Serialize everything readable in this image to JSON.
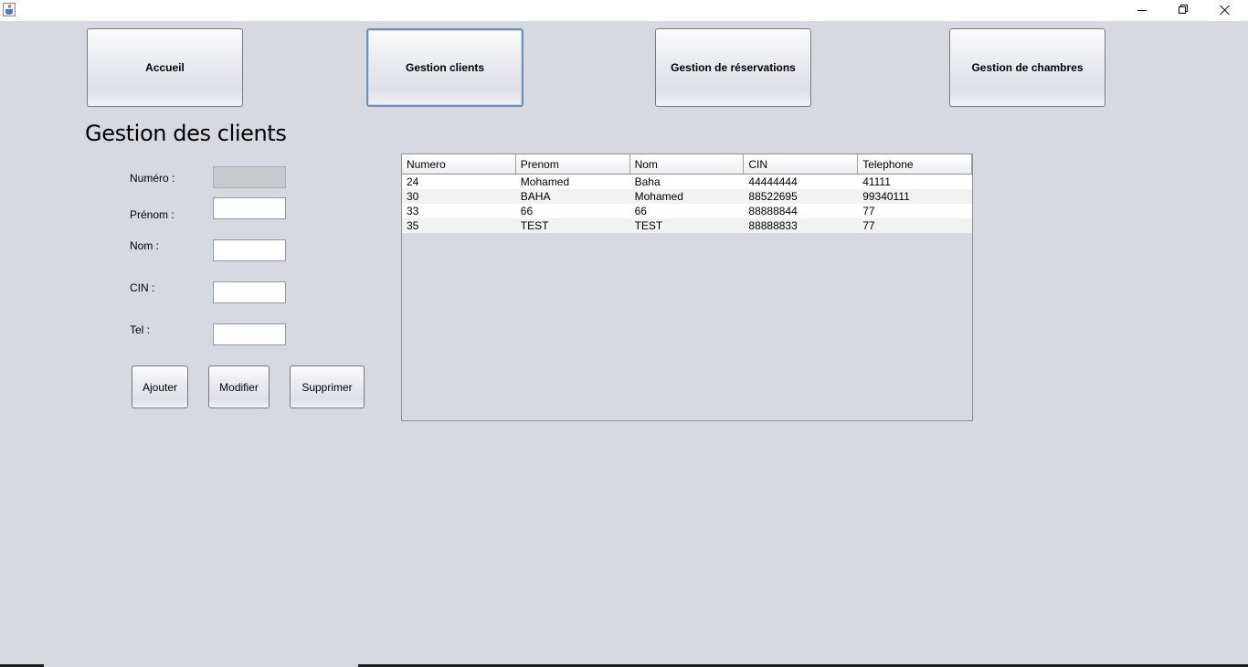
{
  "window": {
    "app_icon": "java-cup-icon",
    "minimize_icon": "minimize-icon",
    "restore_icon": "restore-icon",
    "close_icon": "close-icon"
  },
  "nav": {
    "accueil": "Accueil",
    "clients": "Gestion clients",
    "reservations": "Gestion de réservations",
    "chambres": "Gestion de chambres",
    "active": "clients"
  },
  "page_title": "Gestion des clients",
  "form": {
    "numero_label": "Numéro :",
    "numero_value": "",
    "prenom_label": "Prénom :",
    "prenom_value": "",
    "nom_label": "Nom :",
    "nom_value": "",
    "cin_label": "CIN :",
    "cin_value": "",
    "tel_label": "Tel :",
    "tel_value": ""
  },
  "actions": {
    "ajouter": "Ajouter",
    "modifier": "Modifier",
    "supprimer": "Supprimer"
  },
  "table": {
    "columns": [
      "Numero",
      "Prenom",
      "Nom",
      "CIN",
      "Telephone"
    ],
    "rows": [
      [
        "24",
        "Mohamed",
        "Baha",
        "44444444",
        "41111"
      ],
      [
        "30",
        "BAHA",
        "Mohamed",
        "88522695",
        "99340111"
      ],
      [
        "33",
        "66",
        "66",
        "88888844",
        "77"
      ],
      [
        "35",
        "TEST",
        "TEST",
        "88888833",
        "77"
      ]
    ]
  },
  "colors": {
    "background": "#d6d9e0",
    "active_border": "#6e8fb6"
  }
}
